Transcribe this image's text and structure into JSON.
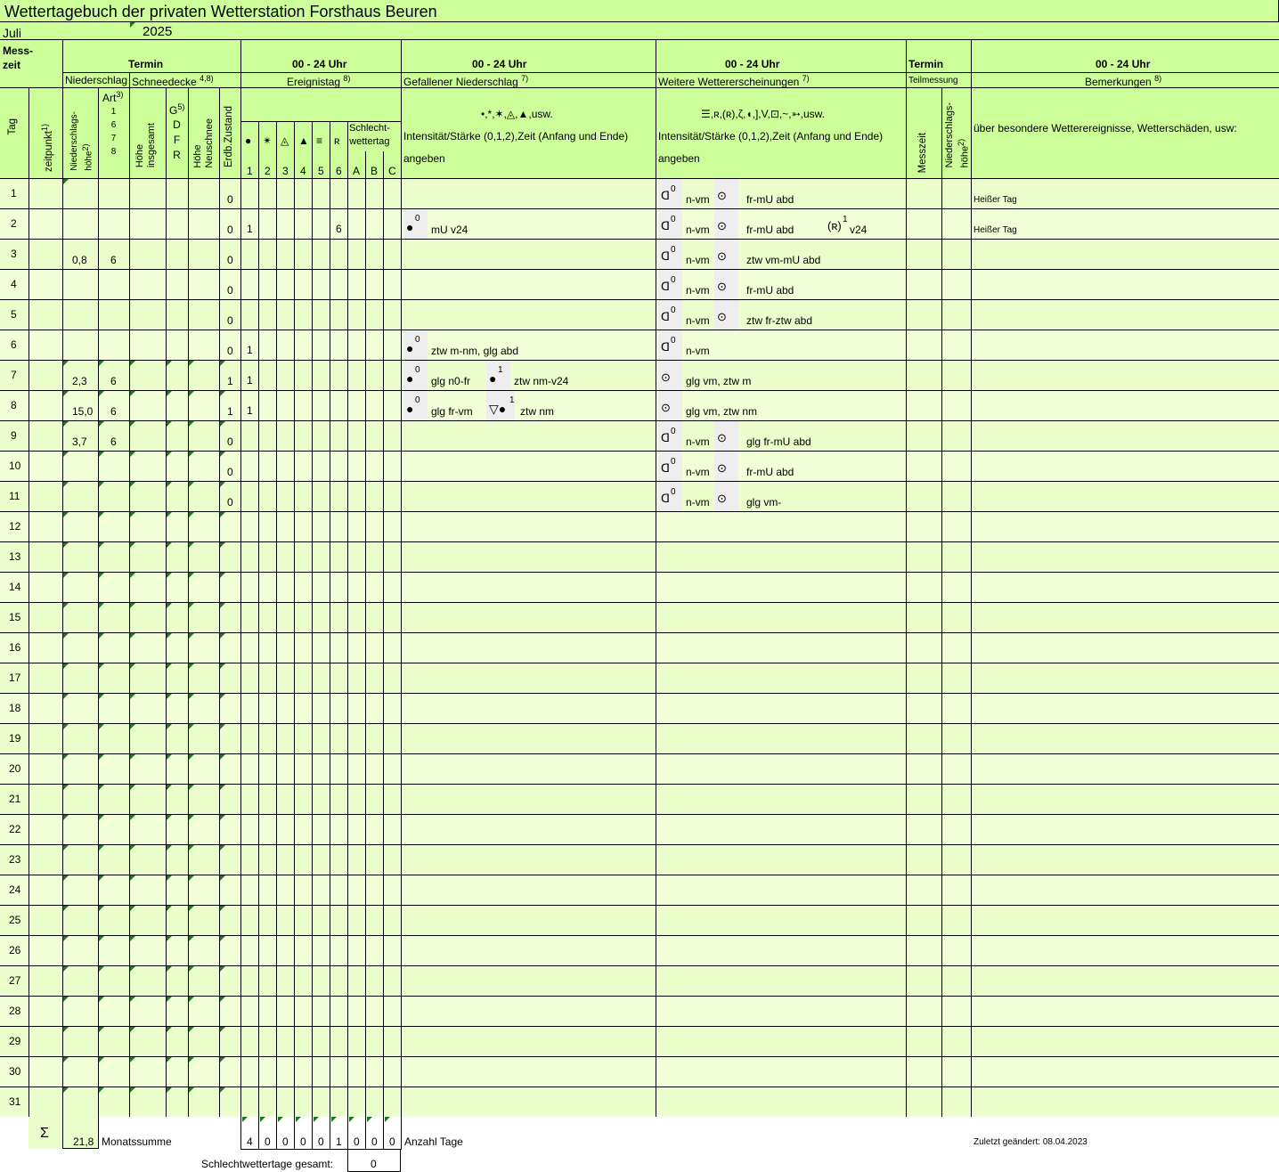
{
  "title": "Wettertagebuch der privaten Wetterstation  Forsthaus Beuren",
  "month": "Juli",
  "year": "2025",
  "header": {
    "messzeit": "Mess-\nzeit",
    "termin": "Termin",
    "uhr": "00 - 24 Uhr",
    "niederschlag": "Niederschlag",
    "schneedecke": "Schneedecke",
    "schneedecke_sup": "4,8)",
    "ereignistag": "Ereignistag",
    "ereignistag_sup": "8)",
    "gefallener": "Gefallener Niederschlag",
    "gefallener_sup": "7)",
    "weitere": "Weitere Wettererscheinungen",
    "weitere_sup": "7)",
    "teilmessung": "Teilmessung",
    "bemerkungen": "Bemerkungen",
    "bemerkungen_sup": "8)",
    "tag": "Tag",
    "zeitpunkt": "zeitpunkt",
    "zeitpunkt_sup": "1)",
    "ns_hoehe": "Niederschlags-\nhöhe",
    "ns_hoehe_sup": "2)",
    "art": "Art",
    "art_sup": "3)",
    "art_codes": [
      "1",
      "6",
      "7",
      "8"
    ],
    "g": "G",
    "g_sup": "5)",
    "gdfr": [
      "D",
      "F",
      "R"
    ],
    "hoehe_insgesamt": "Höhe\ninsgesamt",
    "hoehe_neuschnee": "Höhe\nNeuschnee",
    "erdb": "Erdb.Zustand",
    "ereignis_symbols": [
      "●",
      "✴",
      "◬",
      "▲",
      "≡",
      "ʀ"
    ],
    "ereignis_numbers": [
      "1",
      "2",
      "3",
      "4",
      "5",
      "6"
    ],
    "schlecht": "Schlecht-\nwettertag",
    "abc": [
      "A",
      "B",
      "C"
    ],
    "gef_symbols": "•,*,✶,◬,▲,usw.",
    "intensitaet": "Intensität/Stärke (0,1,2),Zeit (Anfang und Ende)",
    "angeben": "angeben",
    "weit_symbols": "☰,ʀ,(ʀ),ζ,◖,],V,⊡,~,➳,usw.",
    "messzeit2": "Messzeit",
    "ns_hoehe2": "Niederschlags-\nhöhe",
    "bem_text": "über besondere Wetterereignisse, Wetterschäden, usw:"
  },
  "rows": [
    {
      "tag": "1",
      "ns": "",
      "art": "",
      "erdb": "0",
      "e1": "",
      "e6": "",
      "gef": [],
      "weit": [
        {
          "sym": "ᗡ",
          "sup": "0",
          "t": "n-vm"
        },
        {
          "sym": "⊙",
          "sup": "",
          "t": "fr-mU abd"
        }
      ],
      "bem": "Heißer Tag"
    },
    {
      "tag": "2",
      "ns": "",
      "art": "",
      "erdb": "0",
      "e1": "1",
      "e6": "6",
      "gef": [
        {
          "sym": "●",
          "sup": "0",
          "t": "mU v24"
        }
      ],
      "weit": [
        {
          "sym": "ᗡ",
          "sup": "0",
          "t": "n-vm"
        },
        {
          "sym": "⊙",
          "sup": "",
          "t": "fr-mU abd"
        },
        {
          "sym": "(ʀ)",
          "sup": "1",
          "t": "v24"
        }
      ],
      "bem": "Heißer Tag"
    },
    {
      "tag": "3",
      "ns": "0,8",
      "art": "6",
      "erdb": "0",
      "e1": "",
      "e6": "",
      "gef": [],
      "weit": [
        {
          "sym": "ᗡ",
          "sup": "0",
          "t": "n-vm"
        },
        {
          "sym": "⊙",
          "sup": "",
          "t": "ztw vm-mU abd"
        }
      ],
      "bem": ""
    },
    {
      "tag": "4",
      "ns": "",
      "art": "",
      "erdb": "0",
      "e1": "",
      "e6": "",
      "gef": [],
      "weit": [
        {
          "sym": "ᗡ",
          "sup": "0",
          "t": "n-vm"
        },
        {
          "sym": "⊙",
          "sup": "",
          "t": "fr-mU abd"
        }
      ],
      "bem": ""
    },
    {
      "tag": "5",
      "ns": "",
      "art": "",
      "erdb": "0",
      "e1": "",
      "e6": "",
      "gef": [],
      "weit": [
        {
          "sym": "ᗡ",
          "sup": "0",
          "t": "n-vm"
        },
        {
          "sym": "⊙",
          "sup": "",
          "t": "ztw fr-ztw abd"
        }
      ],
      "bem": ""
    },
    {
      "tag": "6",
      "ns": "",
      "art": "",
      "erdb": "0",
      "e1": "1",
      "e6": "",
      "gef": [
        {
          "sym": "●",
          "sup": "0",
          "t": "ztw m-nm, glg abd"
        }
      ],
      "weit": [
        {
          "sym": "ᗡ",
          "sup": "0",
          "t": "n-vm"
        }
      ],
      "bem": ""
    },
    {
      "tag": "7",
      "ns": "2,3",
      "art": "6",
      "erdb": "1",
      "e1": "1",
      "e6": "",
      "gef": [
        {
          "sym": "●",
          "sup": "0",
          "t": "glg n0-fr"
        },
        {
          "sym": "●",
          "sup": "1",
          "t": "ztw nm-v24"
        }
      ],
      "weit": [
        {
          "sym": "⊙",
          "sup": "",
          "t": "glg vm, ztw m"
        }
      ],
      "bem": ""
    },
    {
      "tag": "8",
      "ns": "15,0",
      "art": "6",
      "erdb": "1",
      "e1": "1",
      "e6": "",
      "gef": [
        {
          "sym": "●",
          "sup": "0",
          "t": "glg fr-vm"
        },
        {
          "sym": "▽●",
          "sup": "1",
          "t": "ztw nm"
        }
      ],
      "weit": [
        {
          "sym": "⊙",
          "sup": "",
          "t": "glg vm, ztw nm"
        }
      ],
      "bem": ""
    },
    {
      "tag": "9",
      "ns": "3,7",
      "art": "6",
      "erdb": "0",
      "e1": "",
      "e6": "",
      "gef": [],
      "weit": [
        {
          "sym": "ᗡ",
          "sup": "0",
          "t": "n-vm"
        },
        {
          "sym": "⊙",
          "sup": "",
          "t": "glg fr-mU abd"
        }
      ],
      "bem": ""
    },
    {
      "tag": "10",
      "ns": "",
      "art": "",
      "erdb": "0",
      "e1": "",
      "e6": "",
      "gef": [],
      "weit": [
        {
          "sym": "ᗡ",
          "sup": "0",
          "t": "n-vm"
        },
        {
          "sym": "⊙",
          "sup": "",
          "t": "fr-mU abd"
        }
      ],
      "bem": ""
    },
    {
      "tag": "11",
      "ns": "",
      "art": "",
      "erdb": "0",
      "e1": "",
      "e6": "",
      "gef": [],
      "weit": [
        {
          "sym": "ᗡ",
          "sup": "0",
          "t": "n-vm"
        },
        {
          "sym": "⊙",
          "sup": "",
          "t": "glg vm-"
        }
      ],
      "bem": ""
    },
    {
      "tag": "12"
    },
    {
      "tag": "13"
    },
    {
      "tag": "14"
    },
    {
      "tag": "15"
    },
    {
      "tag": "16"
    },
    {
      "tag": "17"
    },
    {
      "tag": "18"
    },
    {
      "tag": "19"
    },
    {
      "tag": "20"
    },
    {
      "tag": "21"
    },
    {
      "tag": "22"
    },
    {
      "tag": "23"
    },
    {
      "tag": "24"
    },
    {
      "tag": "25"
    },
    {
      "tag": "26"
    },
    {
      "tag": "27"
    },
    {
      "tag": "28"
    },
    {
      "tag": "29"
    },
    {
      "tag": "30"
    },
    {
      "tag": "31"
    }
  ],
  "footer": {
    "sigma": "Σ",
    "monatssumme_value": "21,8",
    "monatssumme_label": "Monatssumme",
    "counts": [
      "4",
      "0",
      "0",
      "0",
      "0",
      "1",
      "0",
      "0",
      "0"
    ],
    "anzahl_tage": "Anzahl Tage",
    "geaendert": "Zuletzt geändert: 08.04.2023",
    "schlecht_label": "Schlechtwettertage gesamt:",
    "schlecht_value": "0"
  },
  "colors": {
    "band": "#ccff99",
    "row_a": "#eaffcc",
    "row_b": "#f0ffd6",
    "marker": "#1f7a1f"
  }
}
